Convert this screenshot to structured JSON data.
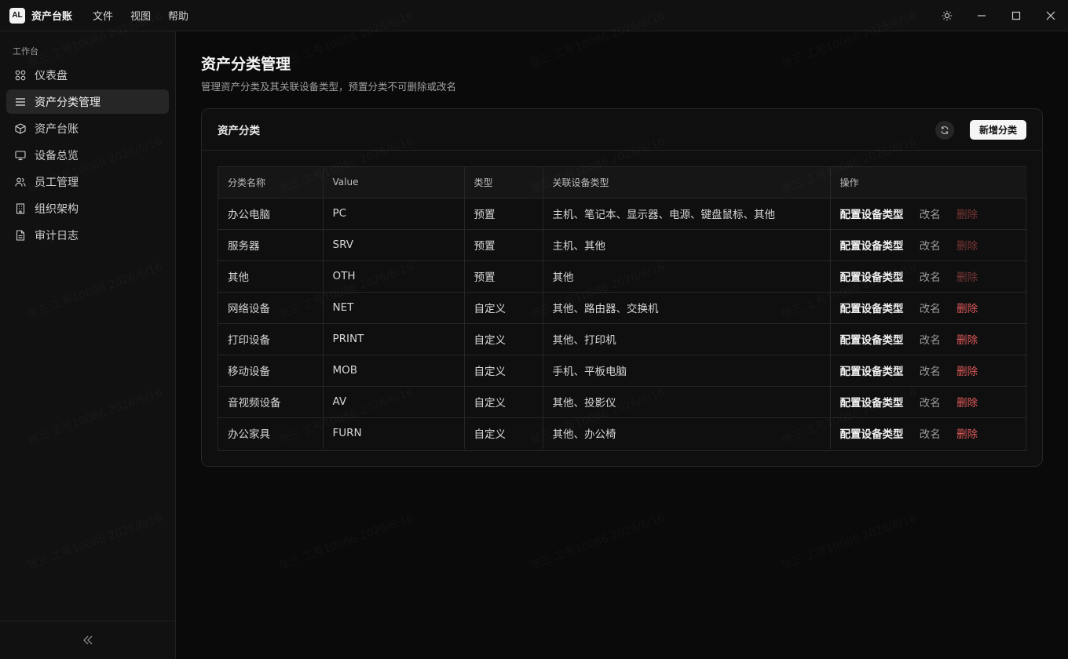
{
  "app": {
    "logo": "AL",
    "title": "资产台账"
  },
  "menu": [
    "文件",
    "视图",
    "帮助"
  ],
  "sidebar": {
    "group": "工作台",
    "items": [
      {
        "label": "仪表盘",
        "icon": "dashboard-icon"
      },
      {
        "label": "资产分类管理",
        "icon": "list-icon",
        "active": true
      },
      {
        "label": "资产台账",
        "icon": "box-icon"
      },
      {
        "label": "设备总览",
        "icon": "monitor-icon"
      },
      {
        "label": "员工管理",
        "icon": "users-icon"
      },
      {
        "label": "组织架构",
        "icon": "building-icon"
      },
      {
        "label": "审计日志",
        "icon": "file-icon"
      }
    ]
  },
  "page": {
    "title": "资产分类管理",
    "subtitle": "管理资产分类及其关联设备类型，预置分类不可删除或改名"
  },
  "card": {
    "title": "资产分类",
    "add_label": "新增分类",
    "columns": [
      "分类名称",
      "Value",
      "类型",
      "关联设备类型",
      "操作"
    ],
    "rows": [
      {
        "name": "办公电脑",
        "value": "PC",
        "type": "预置",
        "devices": "主机、笔记本、显示器、电源、键盘鼠标、其他"
      },
      {
        "name": "服务器",
        "value": "SRV",
        "type": "预置",
        "devices": "主机、其他"
      },
      {
        "name": "其他",
        "value": "OTH",
        "type": "预置",
        "devices": "其他"
      },
      {
        "name": "网络设备",
        "value": "NET",
        "type": "自定义",
        "devices": "其他、路由器、交换机"
      },
      {
        "name": "打印设备",
        "value": "PRINT",
        "type": "自定义",
        "devices": "其他、打印机"
      },
      {
        "name": "移动设备",
        "value": "MOB",
        "type": "自定义",
        "devices": "手机、平板电脑"
      },
      {
        "name": "音视频设备",
        "value": "AV",
        "type": "自定义",
        "devices": "其他、投影仪"
      },
      {
        "name": "办公家具",
        "value": "FURN",
        "type": "自定义",
        "devices": "其他、办公椅"
      }
    ],
    "actions": {
      "config": "配置设备类型",
      "rename": "改名",
      "delete": "删除"
    }
  },
  "watermark": "张三 工号10086 2026/6/16",
  "colors": {
    "delete": "#e05a5a",
    "delete_disabled": "#7a3636",
    "accent": "#f5f5f5"
  }
}
